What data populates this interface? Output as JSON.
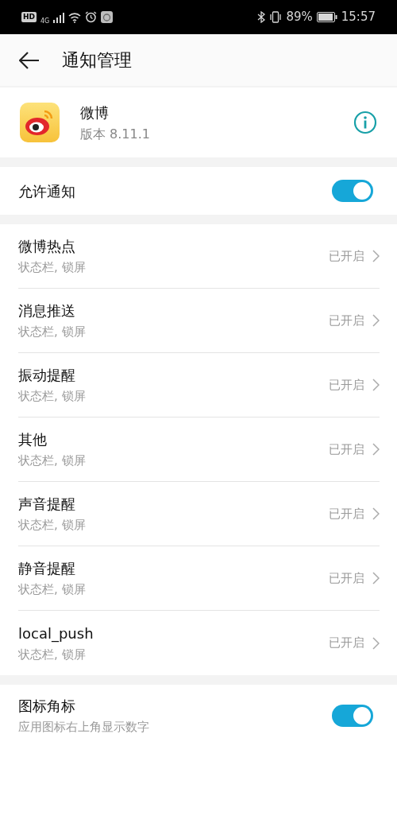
{
  "status_bar": {
    "hd": "HD",
    "network": "4G",
    "battery": "89%",
    "time": "15:57"
  },
  "header": {
    "title": "通知管理"
  },
  "app": {
    "name": "微博",
    "version": "版本 8.11.1"
  },
  "allow": {
    "label": "允许通知",
    "on": true
  },
  "channels": [
    {
      "name": "微博热点",
      "detail": "状态栏, 锁屏",
      "status": "已开启"
    },
    {
      "name": "消息推送",
      "detail": "状态栏, 锁屏",
      "status": "已开启"
    },
    {
      "name": "振动提醒",
      "detail": "状态栏, 锁屏",
      "status": "已开启"
    },
    {
      "name": "其他",
      "detail": "状态栏, 锁屏",
      "status": "已开启"
    },
    {
      "name": "声音提醒",
      "detail": "状态栏, 锁屏",
      "status": "已开启"
    },
    {
      "name": "静音提醒",
      "detail": "状态栏, 锁屏",
      "status": "已开启"
    },
    {
      "name": "local_push",
      "detail": "状态栏, 锁屏",
      "status": "已开启"
    }
  ],
  "badge": {
    "label": "图标角标",
    "detail": "应用图标右上角显示数字",
    "on": true
  }
}
